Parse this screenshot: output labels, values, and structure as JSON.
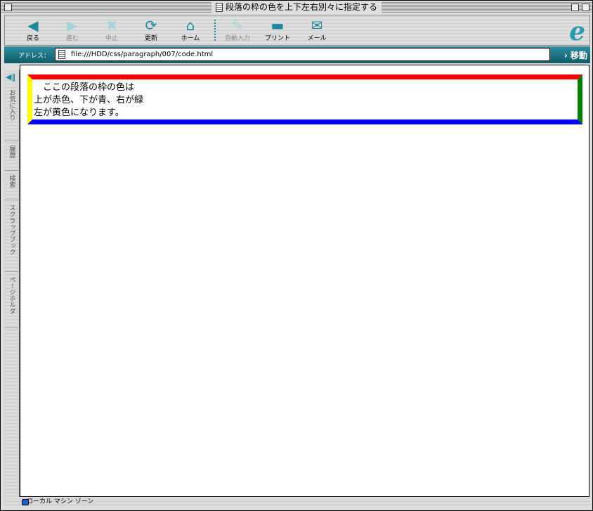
{
  "window": {
    "title": "段落の枠の色を上下左右別々に指定する"
  },
  "toolbar": [
    {
      "label": "戻る",
      "icon": "back-arrow-icon",
      "enabled": true
    },
    {
      "label": "進む",
      "icon": "forward-arrow-icon",
      "enabled": false
    },
    {
      "label": "中止",
      "icon": "stop-icon",
      "enabled": false
    },
    {
      "label": "更新",
      "icon": "refresh-icon",
      "enabled": true
    },
    {
      "label": "ホーム",
      "icon": "home-icon",
      "enabled": true
    },
    {
      "label": "自動入力",
      "icon": "autofill-icon",
      "enabled": false
    },
    {
      "label": "プリント",
      "icon": "print-icon",
      "enabled": true
    },
    {
      "label": "メール",
      "icon": "mail-icon",
      "enabled": true
    }
  ],
  "address": {
    "label": "アドレス：",
    "url": "file:///HDD/css/paragraph/007/code.html",
    "go": "移動"
  },
  "sidebar": [
    "お気に入り",
    "履歴",
    "検索",
    "スクラップブック",
    "ページホルダ"
  ],
  "content": {
    "lines": [
      "　ここの段落の枠の色は",
      "上が赤色、下が青、右が緑",
      "左が黄色になります。"
    ],
    "border_colors": {
      "top": "#ff0000",
      "bottom": "#0000ff",
      "right": "#008000",
      "left": "#ffff00"
    }
  },
  "status": {
    "zone": "ローカル マシン ゾーン"
  }
}
